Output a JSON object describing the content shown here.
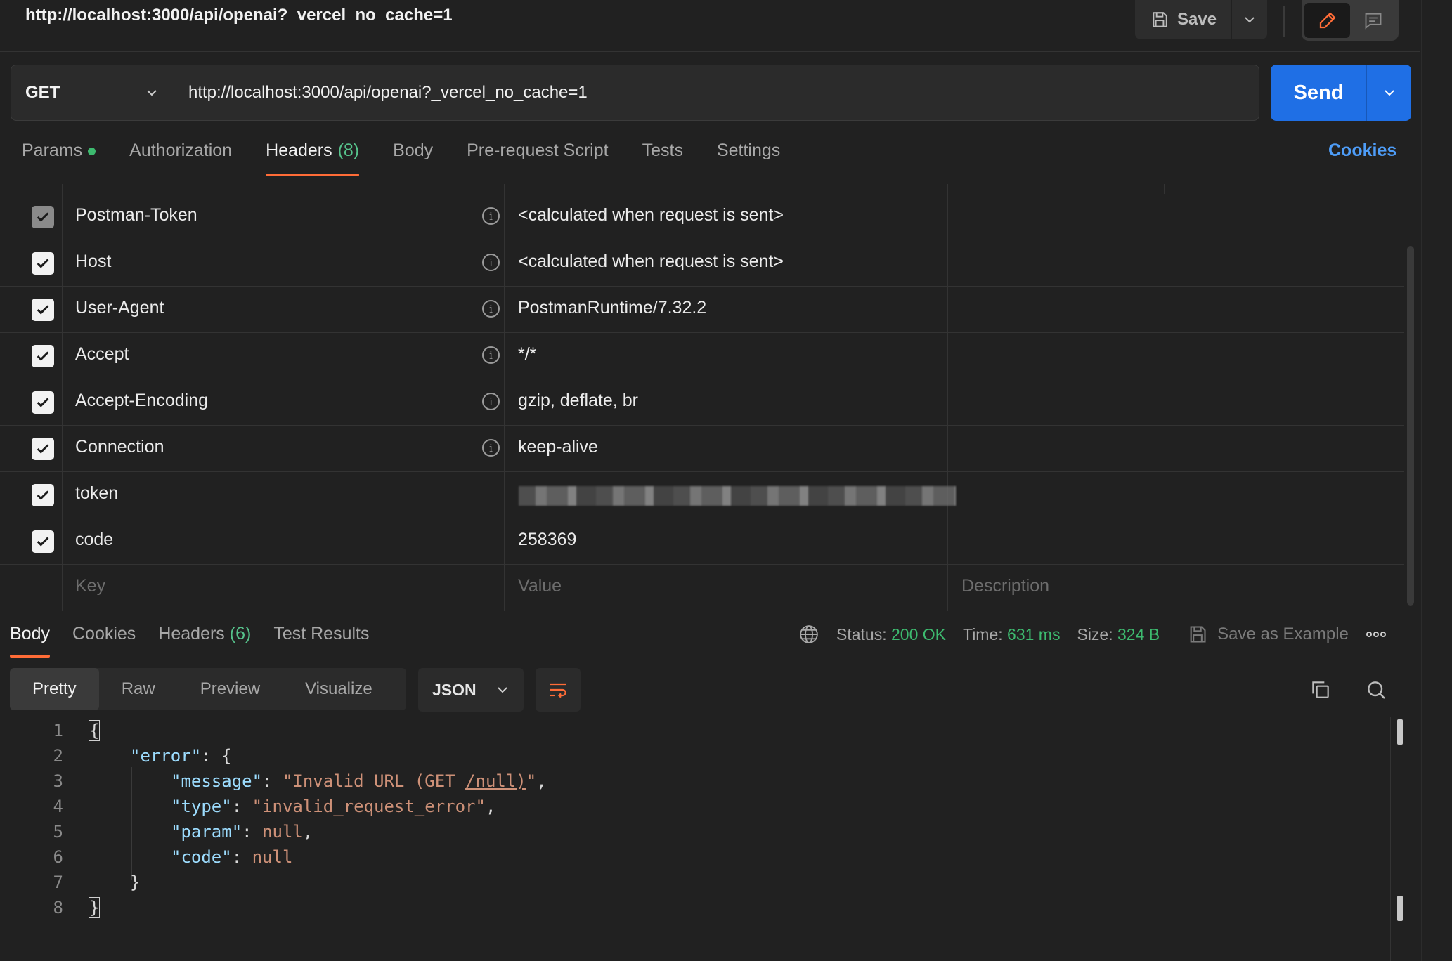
{
  "title_bar": {
    "url": "http://localhost:3000/api/openai?_vercel_no_cache=1",
    "save_label": "Save",
    "save_icon": "floppy-disk-icon",
    "edit_icon": "pencil-icon",
    "comment_icon": "comment-icon"
  },
  "request": {
    "method": "GET",
    "url": "http://localhost:3000/api/openai?_vercel_no_cache=1",
    "send_label": "Send"
  },
  "request_tabs": [
    {
      "label": "Params",
      "indicator": true
    },
    {
      "label": "Authorization"
    },
    {
      "label": "Headers",
      "count": "(8)",
      "active": true
    },
    {
      "label": "Body"
    },
    {
      "label": "Pre-request Script"
    },
    {
      "label": "Tests"
    },
    {
      "label": "Settings"
    }
  ],
  "cookies_link": "Cookies",
  "headers_table": {
    "rows": [
      {
        "key": "Postman-Token",
        "value": "<calculated when request is sent>",
        "checked": true,
        "disabled": true,
        "info": true
      },
      {
        "key": "Host",
        "value": "<calculated when request is sent>",
        "checked": true,
        "info": true
      },
      {
        "key": "User-Agent",
        "value": "PostmanRuntime/7.32.2",
        "checked": true,
        "info": true
      },
      {
        "key": "Accept",
        "value": "*/*",
        "checked": true,
        "info": true
      },
      {
        "key": "Accept-Encoding",
        "value": "gzip, deflate, br",
        "checked": true,
        "info": true
      },
      {
        "key": "Connection",
        "value": "keep-alive",
        "checked": true,
        "info": true
      },
      {
        "key": "token",
        "value": "",
        "checked": true,
        "info": false,
        "redacted": true
      },
      {
        "key": "code",
        "value": "258369",
        "checked": true,
        "info": false
      }
    ],
    "placeholders": {
      "key": "Key",
      "value": "Value",
      "description": "Description"
    }
  },
  "response_tabs": [
    {
      "label": "Body",
      "active": true
    },
    {
      "label": "Cookies"
    },
    {
      "label": "Headers",
      "count": "(6)"
    },
    {
      "label": "Test Results"
    }
  ],
  "response_status": {
    "status_label": "Status:",
    "status_value": "200 OK",
    "time_label": "Time:",
    "time_value": "631 ms",
    "size_label": "Size:",
    "size_value": "324 B",
    "save_example": "Save as Example"
  },
  "view_modes": [
    "Pretty",
    "Raw",
    "Preview",
    "Visualize"
  ],
  "format": "JSON",
  "code_lines": [
    "1",
    "2",
    "3",
    "4",
    "5",
    "6",
    "7",
    "8"
  ],
  "response_json": {
    "error_key": "\"error\"",
    "message_key": "\"message\"",
    "message_value_a": "\"Invalid URL (GET ",
    "message_value_link": "/null)",
    "message_value_b": "\"",
    "type_key": "\"type\"",
    "type_value": "\"invalid_request_error\"",
    "param_key": "\"param\"",
    "param_value": "null",
    "code_key": "\"code\"",
    "code_value": "null"
  },
  "colors": {
    "accent": "#ff6c37",
    "send": "#1f6fe5",
    "link": "#4e9df8",
    "success": "#3dba6f"
  }
}
